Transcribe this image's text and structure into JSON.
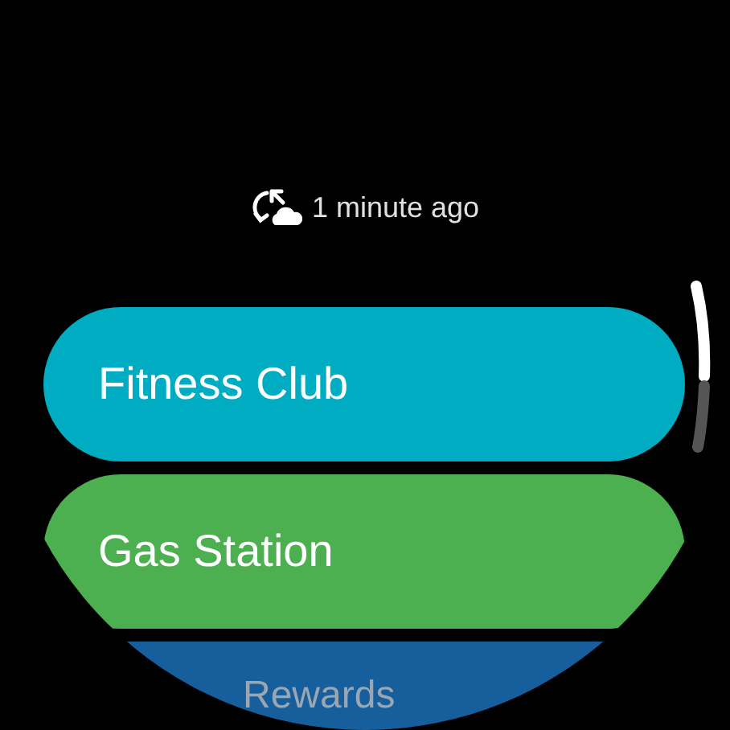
{
  "sync_status": {
    "text": "1 minute ago"
  },
  "cards": [
    {
      "label": "Fitness Club",
      "color": "#00acc1"
    },
    {
      "label": "Gas Station",
      "color": "#4caf50"
    },
    {
      "label": "Rewards",
      "color": "#165f9c"
    }
  ]
}
